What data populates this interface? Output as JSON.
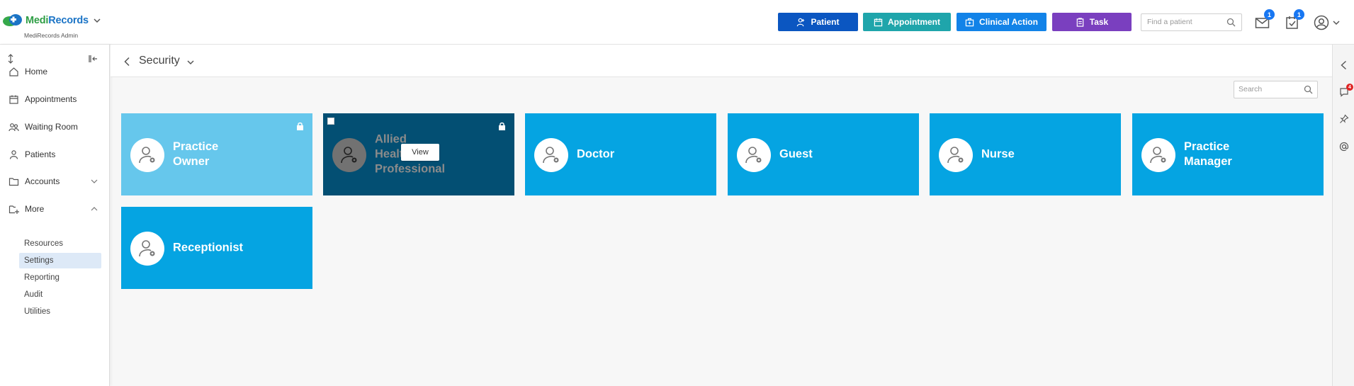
{
  "brand": {
    "medi": "Medi",
    "records": "Records",
    "subtitle": "MediRecords Admin"
  },
  "header": {
    "actions": [
      {
        "label": "Patient",
        "icon": "person-add-icon",
        "color": "#0b56c1"
      },
      {
        "label": "Appointment",
        "icon": "calendar-icon",
        "color": "#1fa5ab"
      },
      {
        "label": "Clinical Action",
        "icon": "medical-bag-icon",
        "color": "#1283e8"
      },
      {
        "label": "Task",
        "icon": "clipboard-icon",
        "color": "#7a3fbf"
      }
    ],
    "find_patient_placeholder": "Find a patient",
    "mail_badge": "1",
    "task_badge": "1"
  },
  "sidebar": {
    "items": [
      {
        "label": "Home",
        "icon": "home-icon"
      },
      {
        "label": "Appointments",
        "icon": "calendar-icon"
      },
      {
        "label": "Waiting Room",
        "icon": "people-icon"
      },
      {
        "label": "Patients",
        "icon": "person-icon"
      },
      {
        "label": "Accounts",
        "icon": "folder-icon",
        "expandable": true
      },
      {
        "label": "More",
        "icon": "folder-plus-icon",
        "expanded": true
      }
    ],
    "sub_items": [
      {
        "label": "Resources"
      },
      {
        "label": "Settings",
        "active": true
      },
      {
        "label": "Reporting"
      },
      {
        "label": "Audit"
      },
      {
        "label": "Utilities"
      }
    ]
  },
  "page": {
    "title": "Security",
    "search_placeholder": "Search"
  },
  "right_rail": {
    "notification_badge": "4"
  },
  "roles": [
    {
      "name": "Practice\nOwner",
      "locked": true,
      "style": "owner"
    },
    {
      "name": "Allied\nHealth\nProfessional",
      "locked": true,
      "hovered": true,
      "view_label": "View"
    },
    {
      "name": "Doctor"
    },
    {
      "name": "Guest"
    },
    {
      "name": "Nurse"
    },
    {
      "name": "Practice\nManager"
    },
    {
      "name": "Receptionist"
    }
  ],
  "colors": {
    "card": "#05a4e2",
    "card_owner": "#66c7ec",
    "card_hover": "#034f73"
  }
}
